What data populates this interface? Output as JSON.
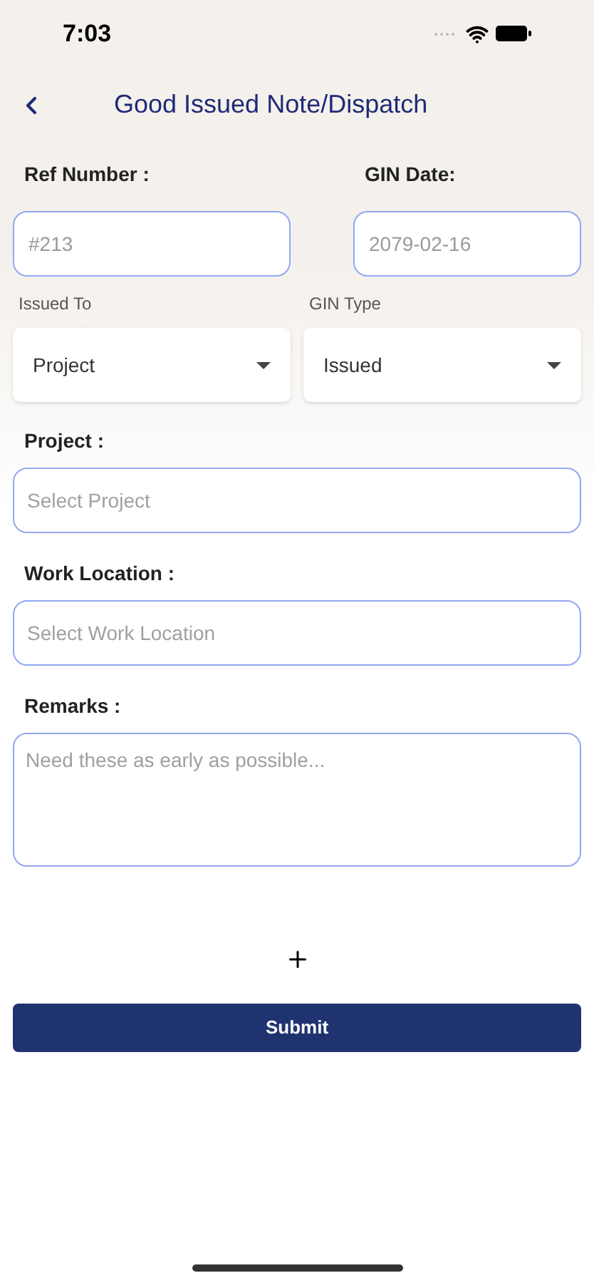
{
  "status_bar": {
    "time": "7:03"
  },
  "header": {
    "title": "Good Issued Note/Dispatch"
  },
  "top_fields": [
    {
      "label": "Ref Number :",
      "placeholder": "#213"
    },
    {
      "label": "GIN Date:",
      "placeholder": "2079-02-16"
    }
  ],
  "dropdowns": [
    {
      "label": "Issued To",
      "value": "Project"
    },
    {
      "label": "GIN Type",
      "value": "Issued"
    }
  ],
  "fields": [
    {
      "label": "Project :",
      "placeholder": "Select Project",
      "kind": "input"
    },
    {
      "label": "Work Location :",
      "placeholder": "Select Work Location",
      "kind": "input"
    },
    {
      "label": "Remarks :",
      "placeholder": "Need these as early as possible...",
      "kind": "textarea"
    }
  ],
  "submit_button": {
    "label": "Submit"
  }
}
